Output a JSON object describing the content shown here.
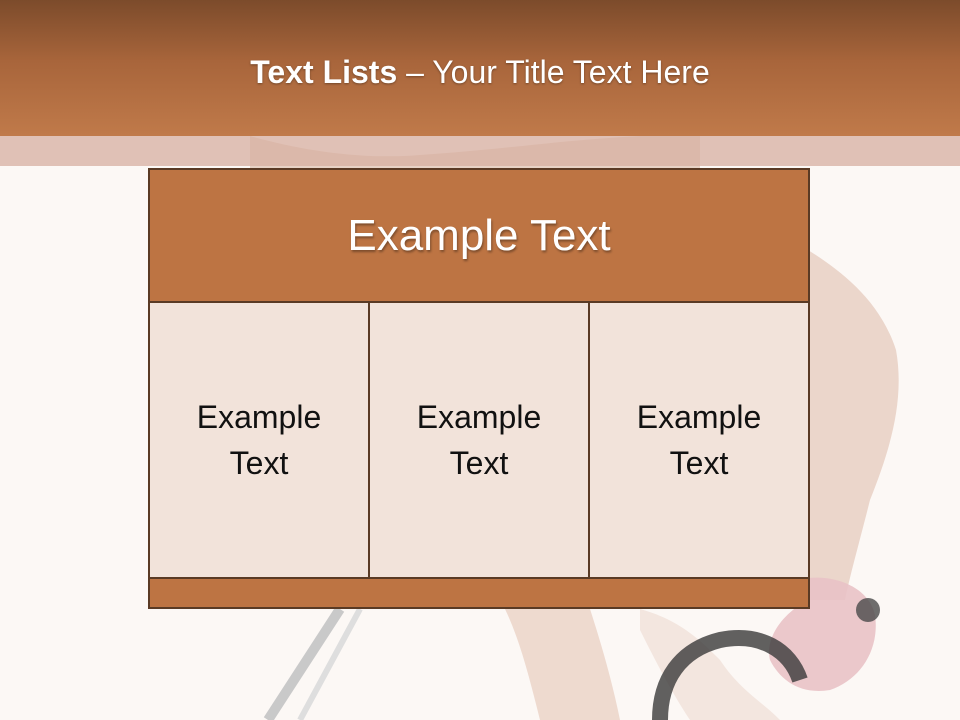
{
  "slide": {
    "title_bold": "Text Lists",
    "title_rest": " – Your Title Text Here",
    "header_text": "Example Text",
    "cells": [
      {
        "text": "Example Text"
      },
      {
        "text": "Example Text"
      },
      {
        "text": "Example Text"
      }
    ]
  },
  "colors": {
    "title_bar": "#a8653b",
    "accent": "#bd7443",
    "cell_fill": "#f2e3da",
    "border": "#5a3a24"
  }
}
